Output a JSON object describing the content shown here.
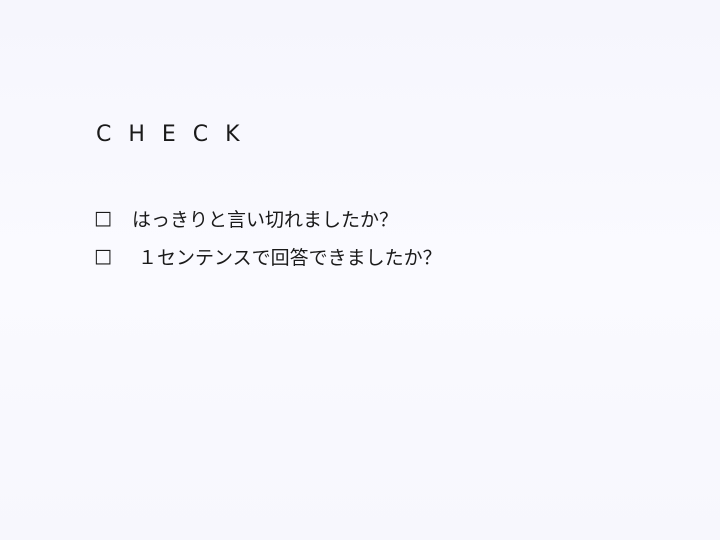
{
  "slide": {
    "title": "C H E C K",
    "checklist": [
      {
        "checkbox_glyph": "□",
        "text": "はっきりと言い切れましたか？"
      },
      {
        "checkbox_glyph": "□",
        "text": " １センテンスで回答できましたか？"
      }
    ]
  }
}
